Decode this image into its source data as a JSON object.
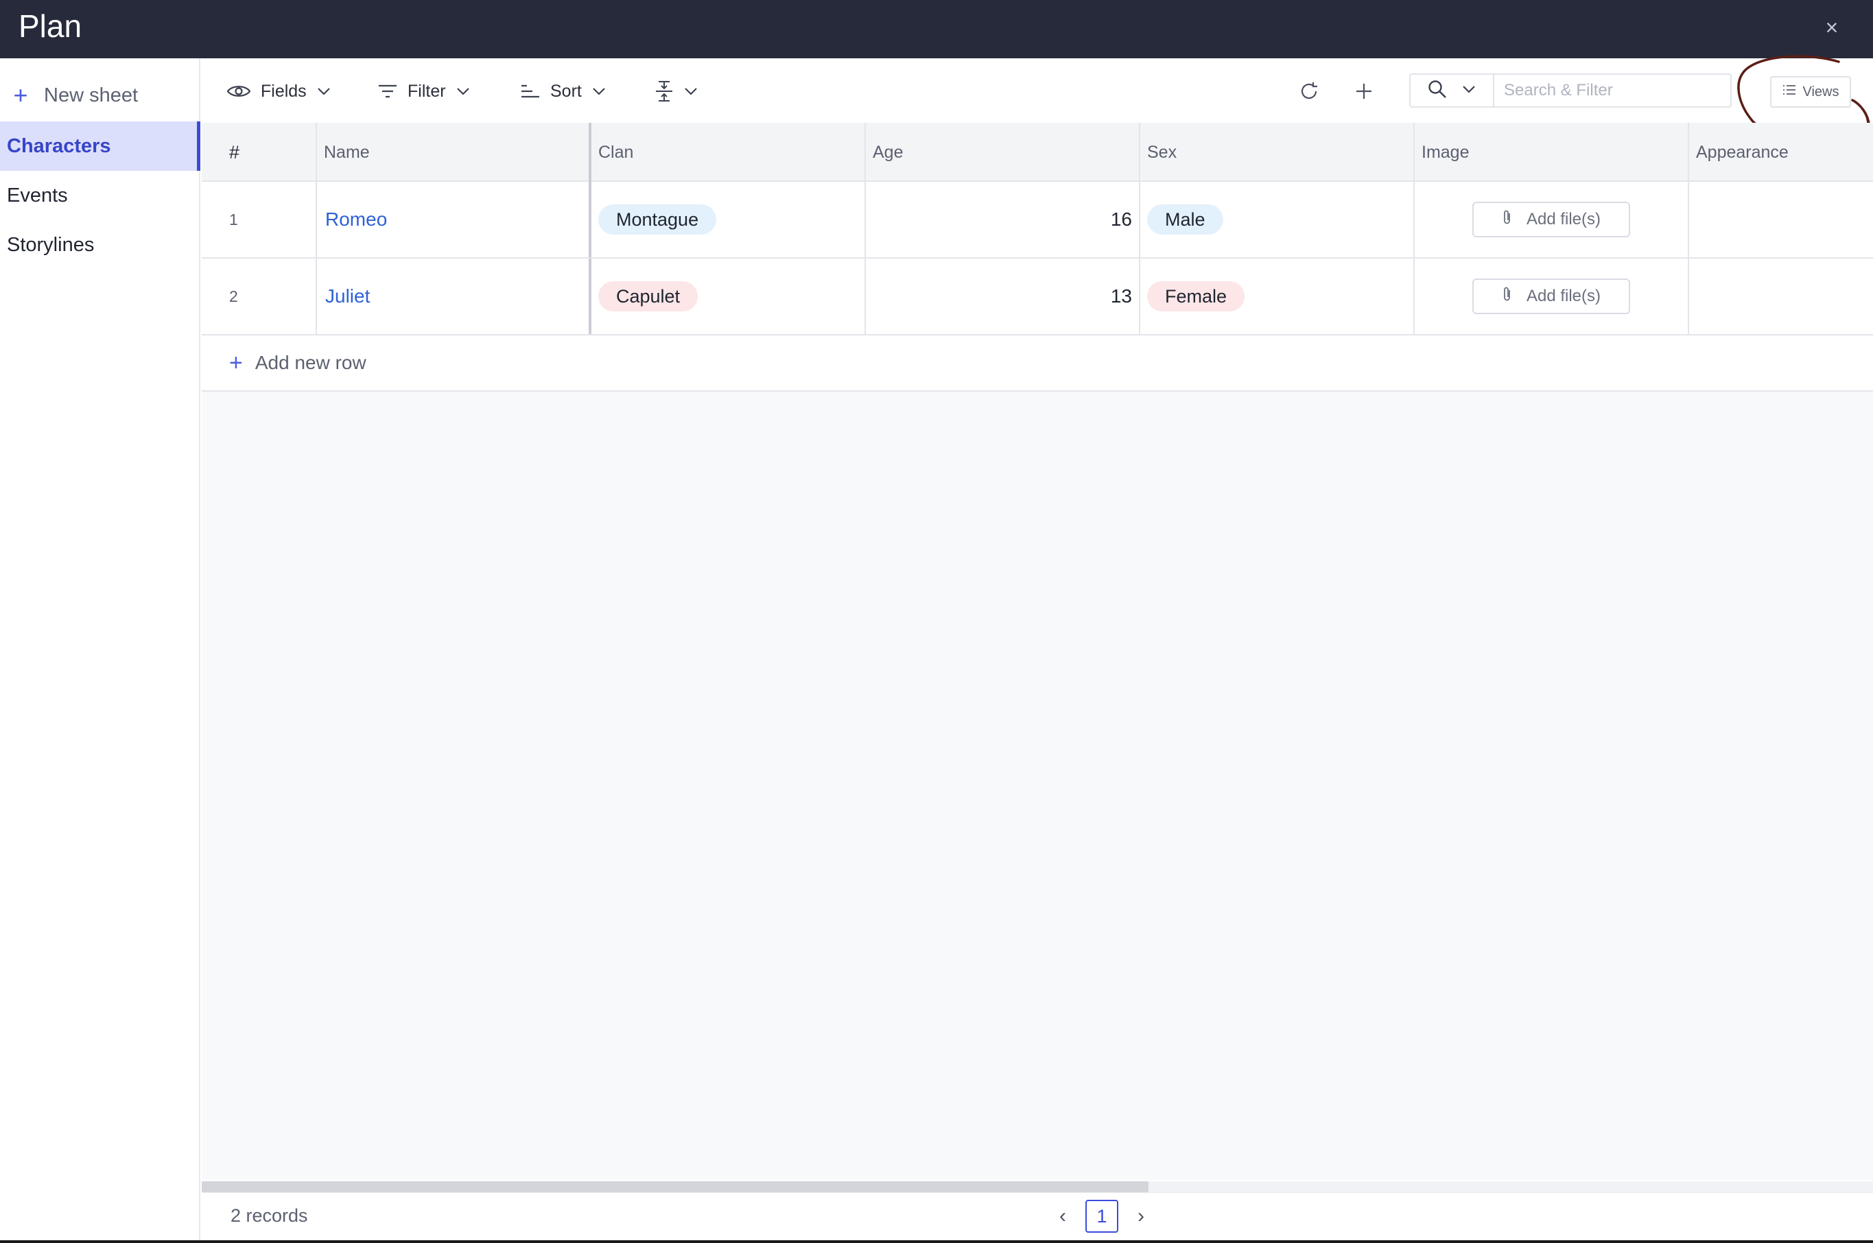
{
  "window": {
    "title": "Plan",
    "close_glyph": "×"
  },
  "sidebar": {
    "new_sheet_label": "New sheet",
    "items": [
      {
        "label": "Characters",
        "active": true
      },
      {
        "label": "Events",
        "active": false
      },
      {
        "label": "Storylines",
        "active": false
      }
    ]
  },
  "toolbar": {
    "fields_label": "Fields",
    "filter_label": "Filter",
    "sort_label": "Sort",
    "search_placeholder": "Search & Filter",
    "views_label": "Views"
  },
  "grid": {
    "columns": [
      "#",
      "Name",
      "Clan",
      "Age",
      "Sex",
      "Image",
      "Appearance"
    ],
    "rows": [
      {
        "num": "1",
        "name": "Romeo",
        "clan": "Montague",
        "age": "16",
        "sex": "Male",
        "image_button": "Add file(s)"
      },
      {
        "num": "2",
        "name": "Juliet",
        "clan": "Capulet",
        "age": "13",
        "sex": "Female",
        "image_button": "Add file(s)"
      }
    ],
    "add_row_label": "Add new row"
  },
  "footer": {
    "records_label": "2 records",
    "current_page": "1"
  },
  "colors": {
    "titlebar": "#272a3b",
    "accent": "#3a4bdc",
    "link": "#2e61d6",
    "pill_blue": "#e3f1fd",
    "pill_pink": "#fde6e7",
    "annotation": "#5a1f17"
  },
  "icons": {
    "fields": "eye-icon",
    "filter": "filter-icon",
    "sort": "sort-icon",
    "row_height": "row-height-icon",
    "reload": "reload-icon",
    "add": "plus-icon",
    "search": "search-icon",
    "views": "list-icon",
    "attachment": "paperclip-icon"
  }
}
